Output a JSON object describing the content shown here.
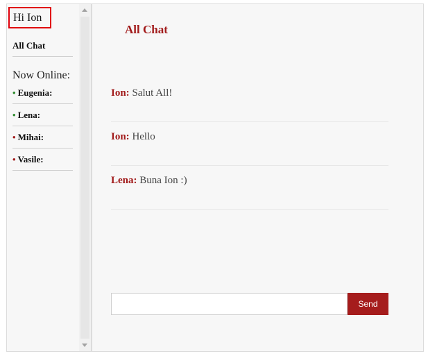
{
  "sidebar": {
    "greeting": "Hi Ion",
    "all_chat": "All Chat",
    "online_heading": "Now Online:",
    "users": [
      {
        "name": "Eugenia:",
        "status_color": "#2c8a2c"
      },
      {
        "name": "Lena:",
        "status_color": "#2c8a2c"
      },
      {
        "name": "Mihai:",
        "status_color": "#a11a1a"
      },
      {
        "name": "Vasile:",
        "status_color": "#a11a1a"
      }
    ]
  },
  "main": {
    "title": "All Chat",
    "messages": [
      {
        "author": "Ion:",
        "text": "Salut All!"
      },
      {
        "author": "Ion:",
        "text": "Hello"
      },
      {
        "author": "Lena:",
        "text": "Buna Ion :)"
      }
    ],
    "composer": {
      "value": "",
      "send_label": "Send"
    }
  },
  "colors": {
    "accent": "#a11a1a",
    "highlight_border": "#e0000b",
    "online": "#2c8a2c",
    "offline": "#a11a1a"
  }
}
